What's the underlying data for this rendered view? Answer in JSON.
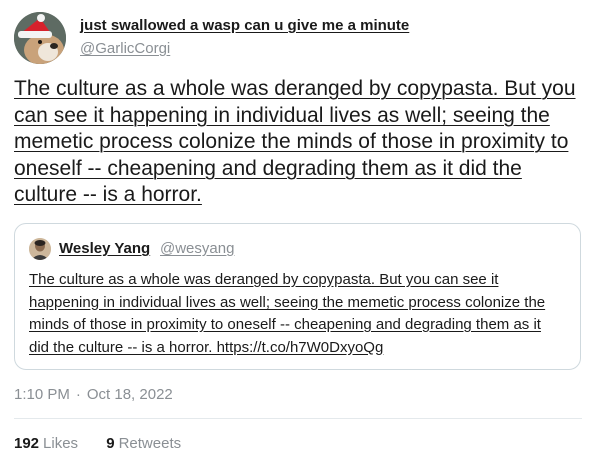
{
  "author": {
    "display_name": "just swallowed a wasp can u give me a minute",
    "handle": "@GarlicCorgi",
    "avatar_icon": "corgi-santa-hat-avatar"
  },
  "tweet": {
    "text": "The culture as a whole was deranged by copypasta. But you can see it happening in individual lives as well; seeing the memetic process colonize the minds of those in proximity to oneself -- cheapening and degrading them as it did the culture -- is a horror."
  },
  "quoted_tweet": {
    "display_name": "Wesley Yang",
    "handle": "@wesyang",
    "avatar_icon": "person-avatar",
    "text": "The culture as a whole was deranged by copypasta. But you can see it happening in individual lives as well; seeing the memetic process colonize the minds of those in proximity to oneself -- cheapening and degrading them as it did the culture -- is a horror. https://t.co/h7W0DxyoQg"
  },
  "meta": {
    "time": "1:10 PM",
    "separator": "·",
    "date": "Oct 18, 2022"
  },
  "stats": {
    "likes_count": "192",
    "likes_label": "Likes",
    "retweets_count": "9",
    "retweets_label": "Retweets"
  },
  "colors": {
    "text": "#1a1a1a",
    "muted": "#8a8f94",
    "border": "#cfd9de"
  }
}
